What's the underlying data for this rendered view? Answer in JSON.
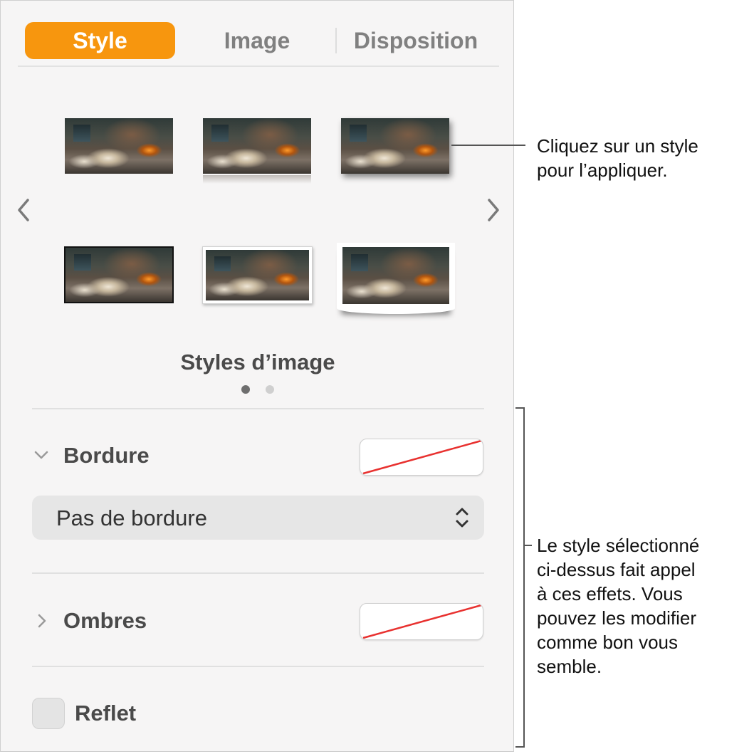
{
  "tabs": [
    {
      "label": "Style",
      "active": true
    },
    {
      "label": "Image",
      "active": false
    },
    {
      "label": "Disposition",
      "active": false
    }
  ],
  "image_styles": {
    "title": "Styles d’image",
    "page_count": 2,
    "current_page": 1,
    "thumbnails": [
      {
        "name": "plain"
      },
      {
        "name": "reflection"
      },
      {
        "name": "drop-shadow"
      },
      {
        "name": "thin-border"
      },
      {
        "name": "white-frame"
      },
      {
        "name": "curled-frame"
      }
    ],
    "prev_icon": "chevron-left-icon",
    "next_icon": "chevron-right-icon"
  },
  "border": {
    "label": "Bordure",
    "expanded": true,
    "color_well": "none",
    "popup_value": "Pas de bordure"
  },
  "shadows": {
    "label": "Ombres",
    "expanded": false,
    "color_well": "none"
  },
  "reflection": {
    "label": "Reflet",
    "checked": false
  },
  "callouts": {
    "top": [
      "Cliquez sur un style",
      "pour l’appliquer."
    ],
    "bottom": [
      "Le style sélectionné",
      "ci-dessus fait appel",
      "à ces effets. Vous",
      "pouvez les modifier",
      "comme bon vous",
      "semble."
    ]
  },
  "colors": {
    "accent": "#f7960e",
    "none_slash": "#e8312f"
  }
}
